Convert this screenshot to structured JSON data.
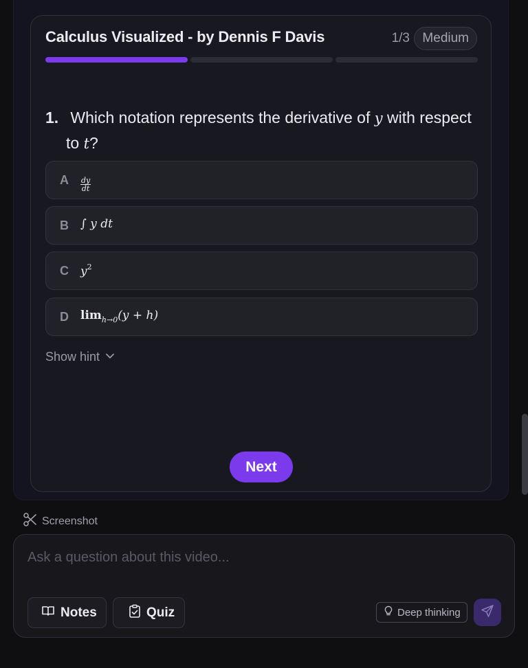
{
  "quiz": {
    "title": "Calculus Visualized - by Dennis F Davis",
    "progress": "1/3",
    "progress_fraction": 0.333,
    "difficulty": "Medium",
    "question_number": "1.",
    "question_text_part1": "Which notation represents the derivative of",
    "question_var1": "y",
    "question_text_part2": "with respect",
    "question_text_part3": "to",
    "question_var2": "t",
    "question_text_end": "?",
    "options": [
      {
        "letter": "A",
        "numerator": "dy",
        "denominator": "dt"
      },
      {
        "letter": "B",
        "text": "∫ y dt"
      },
      {
        "letter": "C",
        "base": "y",
        "exponent": "2"
      },
      {
        "letter": "D",
        "op": "lim",
        "subscript": "h→0",
        "expr": "(y + h)"
      }
    ],
    "hint_label": "Show hint",
    "next_label": "Next"
  },
  "chat": {
    "screenshot_label": "Screenshot",
    "input_placeholder": "Ask a question about this video...",
    "notes_label": "Notes",
    "quiz_label": "Quiz",
    "deep_thinking_label": "Deep thinking"
  },
  "colors": {
    "accent": "#7c3aed",
    "background": "#0f0f12",
    "card": "#181820"
  }
}
